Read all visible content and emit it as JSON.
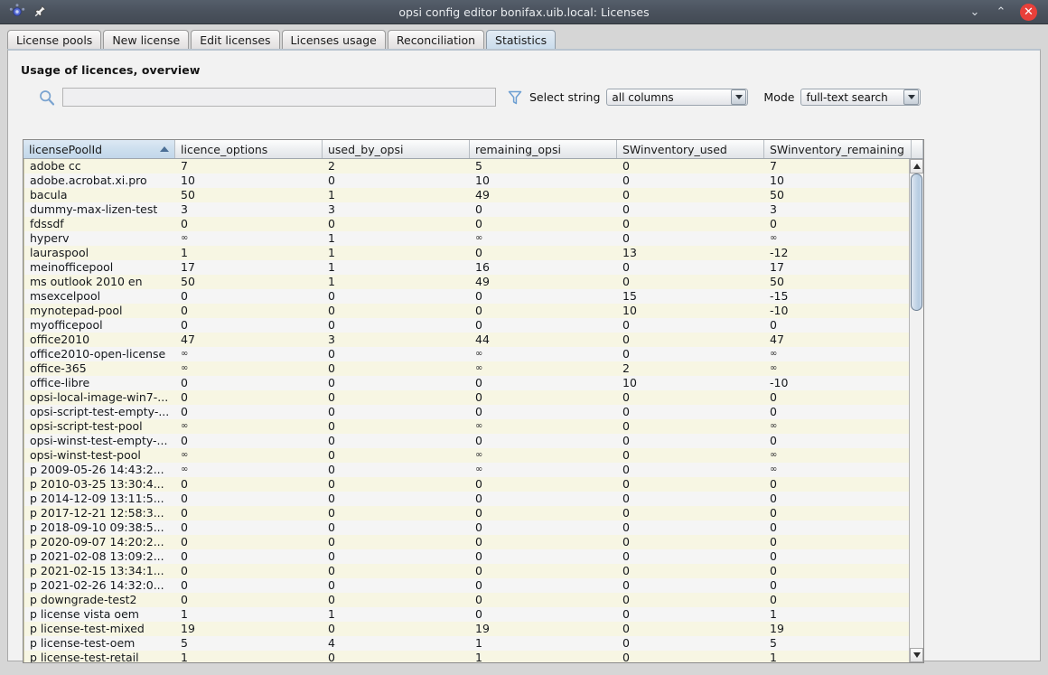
{
  "window": {
    "title": "opsi config editor bonifax.uib.local: Licenses",
    "app_icon": "opsi-logo-icon",
    "pin_icon": "pin-icon",
    "minimize_label": "⌄",
    "maximize_label": "⌃",
    "close_label": "✕"
  },
  "tabs": [
    {
      "label": "License pools",
      "active": false
    },
    {
      "label": "New license",
      "active": false
    },
    {
      "label": "Edit licenses",
      "active": false
    },
    {
      "label": "Licenses usage",
      "active": false
    },
    {
      "label": "Reconciliation",
      "active": false
    },
    {
      "label": "Statistics",
      "active": true
    }
  ],
  "panel": {
    "title": "Usage of licences, overview"
  },
  "toolbar": {
    "search_icon": "search-icon",
    "search_value": "",
    "search_placeholder": "",
    "filter_icon": "filter-funnel-icon",
    "select_string_label": "Select string",
    "select_string_value": "all columns",
    "select_string_options": [
      "all columns"
    ],
    "mode_label": "Mode",
    "mode_value": "full-text search",
    "mode_options": [
      "full-text search"
    ]
  },
  "table": {
    "sort_column": "licensePoolId",
    "sort_direction": "ascending",
    "columns": [
      {
        "label": "licensePoolId",
        "width": 168,
        "sorted": true
      },
      {
        "label": "licence_options",
        "width": 163,
        "sorted": false
      },
      {
        "label": "used_by_opsi",
        "width": 163,
        "sorted": false
      },
      {
        "label": "remaining_opsi",
        "width": 163,
        "sorted": false
      },
      {
        "label": "SWinventory_used",
        "width": 163,
        "sorted": false
      },
      {
        "label": "SWinventory_remaining",
        "width": 163,
        "sorted": false
      }
    ],
    "rows": [
      [
        "adobe cc",
        "7",
        "2",
        "5",
        "0",
        "7"
      ],
      [
        "adobe.acrobat.xi.pro",
        "10",
        "0",
        "10",
        "0",
        "10"
      ],
      [
        "bacula",
        "50",
        "1",
        "49",
        "0",
        "50"
      ],
      [
        "dummy-max-lizen-test",
        "3",
        "3",
        "0",
        "0",
        "3"
      ],
      [
        "fdssdf",
        "0",
        "0",
        "0",
        "0",
        "0"
      ],
      [
        "hyperv",
        "∞",
        "1",
        "∞",
        "0",
        "∞"
      ],
      [
        "lauraspool",
        "1",
        "1",
        "0",
        "13",
        "-12"
      ],
      [
        "meinofficepool",
        "17",
        "1",
        "16",
        "0",
        "17"
      ],
      [
        "ms outlook 2010 en",
        "50",
        "1",
        "49",
        "0",
        "50"
      ],
      [
        "msexcelpool",
        "0",
        "0",
        "0",
        "15",
        "-15"
      ],
      [
        "mynotepad-pool",
        "0",
        "0",
        "0",
        "10",
        "-10"
      ],
      [
        "myofficepool",
        "0",
        "0",
        "0",
        "0",
        "0"
      ],
      [
        "office2010",
        "47",
        "3",
        "44",
        "0",
        "47"
      ],
      [
        "office2010-open-license",
        "∞",
        "0",
        "∞",
        "0",
        "∞"
      ],
      [
        "office-365",
        "∞",
        "0",
        "∞",
        "2",
        "∞"
      ],
      [
        "office-libre",
        "0",
        "0",
        "0",
        "10",
        "-10"
      ],
      [
        "opsi-local-image-win7-...",
        "0",
        "0",
        "0",
        "0",
        "0"
      ],
      [
        "opsi-script-test-empty-...",
        "0",
        "0",
        "0",
        "0",
        "0"
      ],
      [
        "opsi-script-test-pool",
        "∞",
        "0",
        "∞",
        "0",
        "∞"
      ],
      [
        "opsi-winst-test-empty-...",
        "0",
        "0",
        "0",
        "0",
        "0"
      ],
      [
        "opsi-winst-test-pool",
        "∞",
        "0",
        "∞",
        "0",
        "∞"
      ],
      [
        "p 2009-05-26 14:43:2...",
        "∞",
        "0",
        "∞",
        "0",
        "∞"
      ],
      [
        "p 2010-03-25 13:30:4...",
        "0",
        "0",
        "0",
        "0",
        "0"
      ],
      [
        "p 2014-12-09 13:11:5...",
        "0",
        "0",
        "0",
        "0",
        "0"
      ],
      [
        "p 2017-12-21 12:58:3...",
        "0",
        "0",
        "0",
        "0",
        "0"
      ],
      [
        "p 2018-09-10 09:38:5...",
        "0",
        "0",
        "0",
        "0",
        "0"
      ],
      [
        "p 2020-09-07 14:20:2...",
        "0",
        "0",
        "0",
        "0",
        "0"
      ],
      [
        "p 2021-02-08 13:09:2...",
        "0",
        "0",
        "0",
        "0",
        "0"
      ],
      [
        "p 2021-02-15 13:34:1...",
        "0",
        "0",
        "0",
        "0",
        "0"
      ],
      [
        "p 2021-02-26 14:32:0...",
        "0",
        "0",
        "0",
        "0",
        "0"
      ],
      [
        "p downgrade-test2",
        "0",
        "0",
        "0",
        "0",
        "0"
      ],
      [
        "p license vista oem",
        "1",
        "1",
        "0",
        "0",
        "1"
      ],
      [
        "p license-test-mixed",
        "19",
        "0",
        "19",
        "0",
        "19"
      ],
      [
        "p license-test-oem",
        "5",
        "4",
        "1",
        "0",
        "5"
      ],
      [
        "p license-test-retail",
        "1",
        "0",
        "1",
        "0",
        "1"
      ]
    ],
    "scrollbar": {
      "up_arrow": "scroll-up-icon",
      "down_arrow": "scroll-down-icon",
      "thumb_top_pct": 0,
      "thumb_height_pct": 29
    }
  },
  "colors": {
    "titlebar": "#4a525d",
    "close_button": "#e8403a",
    "active_tab": "#cadcec",
    "row_odd": "#f7f6e3",
    "row_even": "#f5f5f5",
    "header_sorted": "#cddfee",
    "panel_bg": "#f2f2f2"
  }
}
